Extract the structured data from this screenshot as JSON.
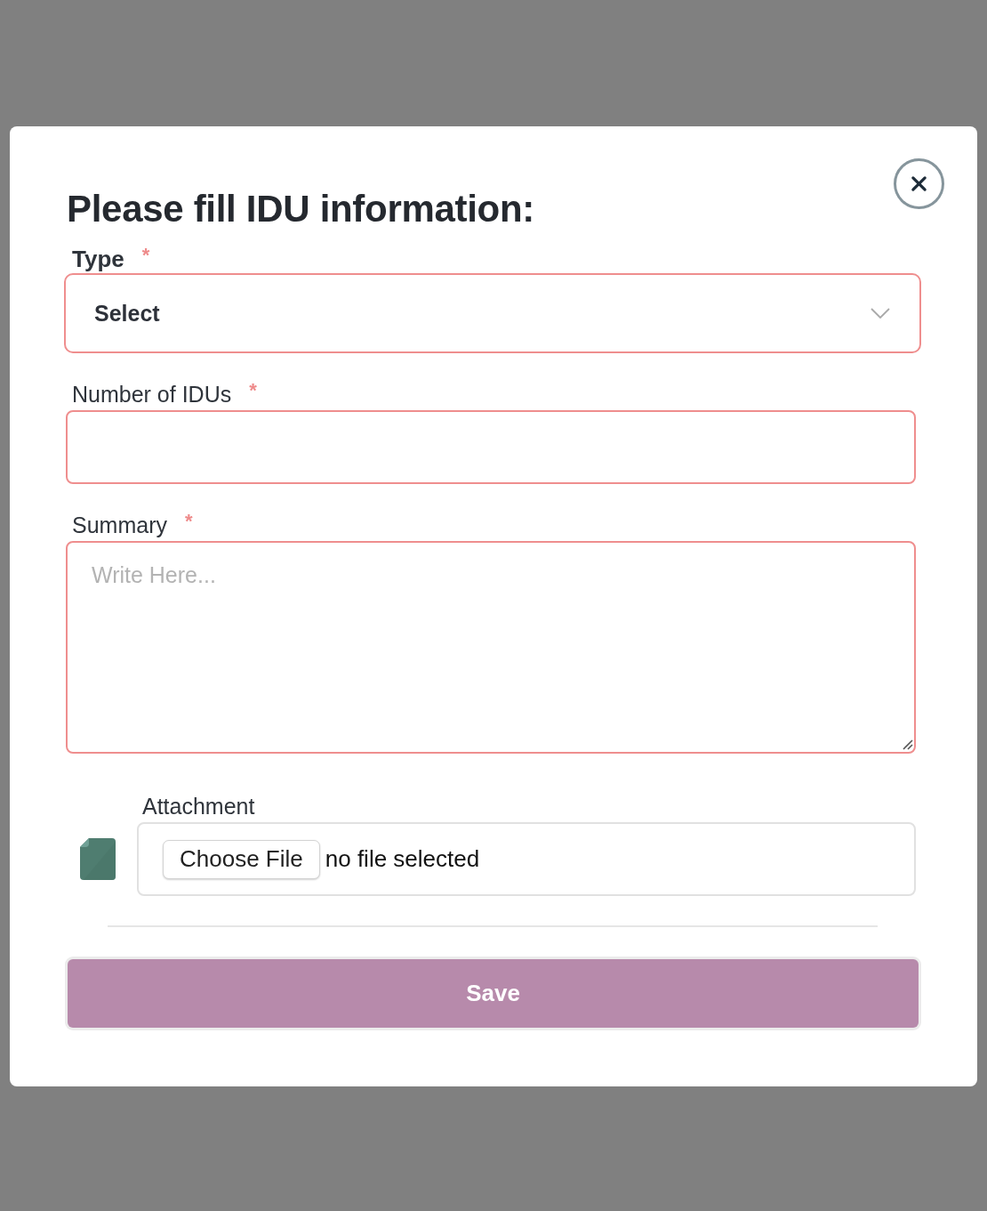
{
  "dialog": {
    "title": "Please fill IDU information:"
  },
  "fields": [
    {
      "kind": "select",
      "label": "Type",
      "required_mark": "*",
      "value": "Select"
    },
    {
      "kind": "text",
      "label": "Number of IDUs",
      "required_mark": "*"
    },
    {
      "kind": "textarea",
      "label": "Summary",
      "required_mark": "*",
      "placeholder": "Write Here..."
    },
    {
      "kind": "file",
      "label": "Attachment",
      "button": "Choose File",
      "status": "no file selected"
    }
  ],
  "save_button": {
    "label": "Save"
  }
}
